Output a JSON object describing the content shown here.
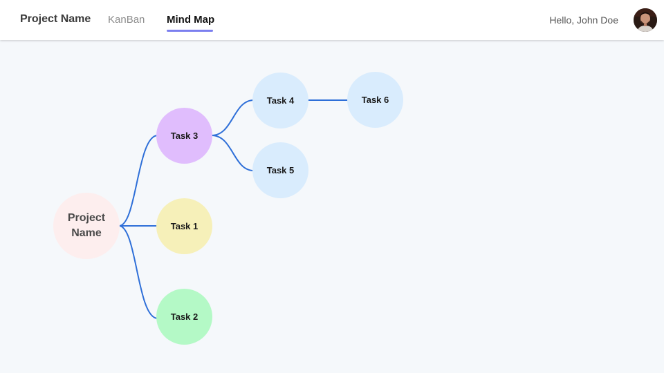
{
  "header": {
    "project_name": "Project Name",
    "tabs": [
      {
        "label": "KanBan",
        "active": false
      },
      {
        "label": "Mind Map",
        "active": true
      }
    ],
    "greeting": "Hello, John Doe",
    "accent_color": "#7b7fef"
  },
  "mindmap": {
    "link_color": "#2e6fd8",
    "root": {
      "label_line1": "Project",
      "label_line2": "Name",
      "color": "#fdeeee"
    },
    "nodes": {
      "task1": {
        "label": "Task 1",
        "color": "#f6f0b9"
      },
      "task2": {
        "label": "Task 2",
        "color": "#b4f9c6"
      },
      "task3": {
        "label": "Task 3",
        "color": "#e0bdfd"
      },
      "task4": {
        "label": "Task 4",
        "color": "#d9ecfd"
      },
      "task5": {
        "label": "Task 5",
        "color": "#d9ecfd"
      },
      "task6": {
        "label": "Task 6",
        "color": "#d9ecfd"
      }
    }
  }
}
